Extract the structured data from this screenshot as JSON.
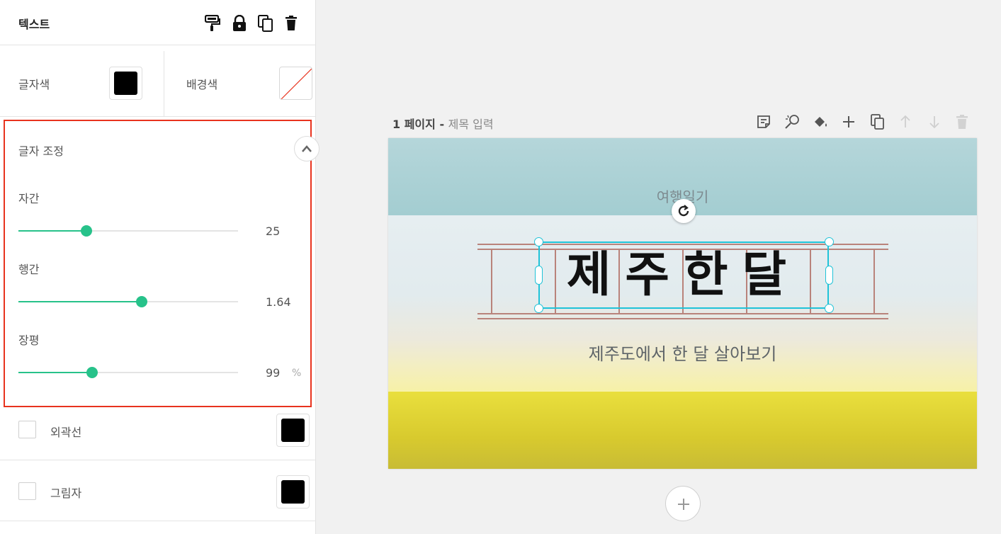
{
  "panel": {
    "title": "텍스트",
    "header_icons": [
      "paint-roller-icon",
      "lock-icon",
      "copy-icon",
      "trash-icon"
    ],
    "text_color": {
      "label": "글자색",
      "value": "#000000"
    },
    "background_color": {
      "label": "배경색",
      "value": "none"
    },
    "adjust": {
      "title": "글자 조정",
      "sliders": [
        {
          "label": "자간",
          "value": "25",
          "fraction": 0.31,
          "unit": ""
        },
        {
          "label": "행간",
          "value": "1.64",
          "fraction": 0.56,
          "unit": ""
        },
        {
          "label": "장평",
          "value": "99",
          "fraction": 0.335,
          "unit": "%"
        }
      ]
    },
    "outline": {
      "label": "외곽선",
      "checked": false,
      "color": "#000000"
    },
    "shadow": {
      "label": "그림자",
      "checked": false,
      "color": "#000000"
    }
  },
  "page": {
    "number": "1 페이지",
    "separator": " - ",
    "title": "제목 입력",
    "toolbar_icons": [
      "note-icon",
      "magic-icon",
      "fill-icon",
      "add-icon",
      "duplicate-icon",
      "move-up-icon",
      "move-down-icon",
      "delete-icon"
    ],
    "canvas": {
      "small_text": "여행일기",
      "main_text": "제주한달",
      "sub_text": "제주도에서 한 달 살아보기"
    }
  },
  "colors": {
    "accent": "#27c28a",
    "highlight": "#e8331e",
    "selection": "#20c3d8"
  }
}
